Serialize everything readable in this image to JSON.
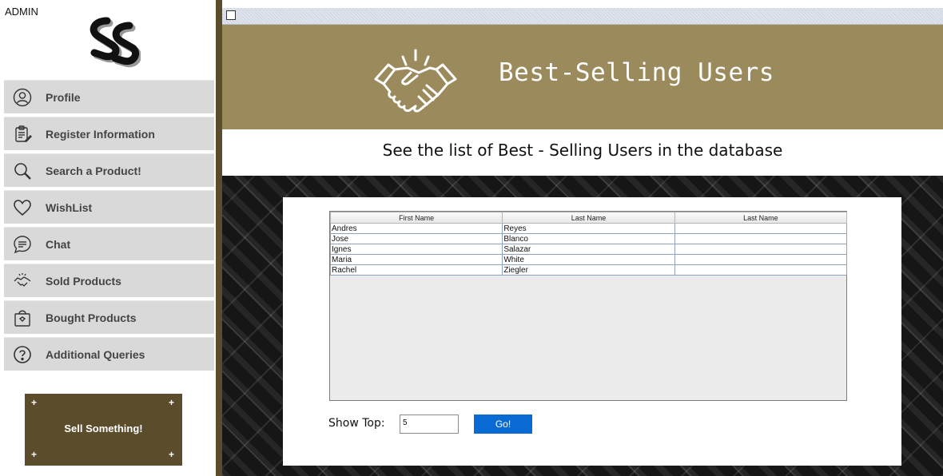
{
  "sidebar": {
    "user_label": "ADMIN",
    "logo_icon": "ss-logo-icon",
    "items": [
      {
        "label": "Profile",
        "icon": "user-circle-icon"
      },
      {
        "label": "Register Information",
        "icon": "clipboard-icon"
      },
      {
        "label": "Search a Product!",
        "icon": "search-icon"
      },
      {
        "label": "WishList",
        "icon": "heart-icon"
      },
      {
        "label": "Chat",
        "icon": "chat-bubble-icon"
      },
      {
        "label": "Sold Products",
        "icon": "handshake-icon"
      },
      {
        "label": "Bought Products",
        "icon": "shopping-bag-icon"
      },
      {
        "label": "Additional Queries",
        "icon": "question-circle-icon"
      }
    ],
    "sell_button": "Sell Something!"
  },
  "header": {
    "title": "Best-Selling Users",
    "icon": "handshake-icon",
    "subtitle": "See the list of Best - Selling Users in the database"
  },
  "table": {
    "columns": [
      "First Name",
      "Last Name",
      "Last Name"
    ],
    "rows": [
      [
        "Andres",
        "Reyes",
        ""
      ],
      [
        "Jose",
        "Blanco",
        ""
      ],
      [
        "Ignes",
        "Salazar",
        ""
      ],
      [
        "Maria",
        "White",
        ""
      ],
      [
        "Rachel",
        "Ziegler",
        ""
      ]
    ]
  },
  "controls": {
    "show_top_label": "Show Top:",
    "show_top_value": "5",
    "go_button": "Go!"
  },
  "colors": {
    "accent": "#5b4d2c",
    "header_band": "#9a8a5c",
    "go_button": "#0a6ad4",
    "nav_item_bg": "#d9d9d9"
  }
}
